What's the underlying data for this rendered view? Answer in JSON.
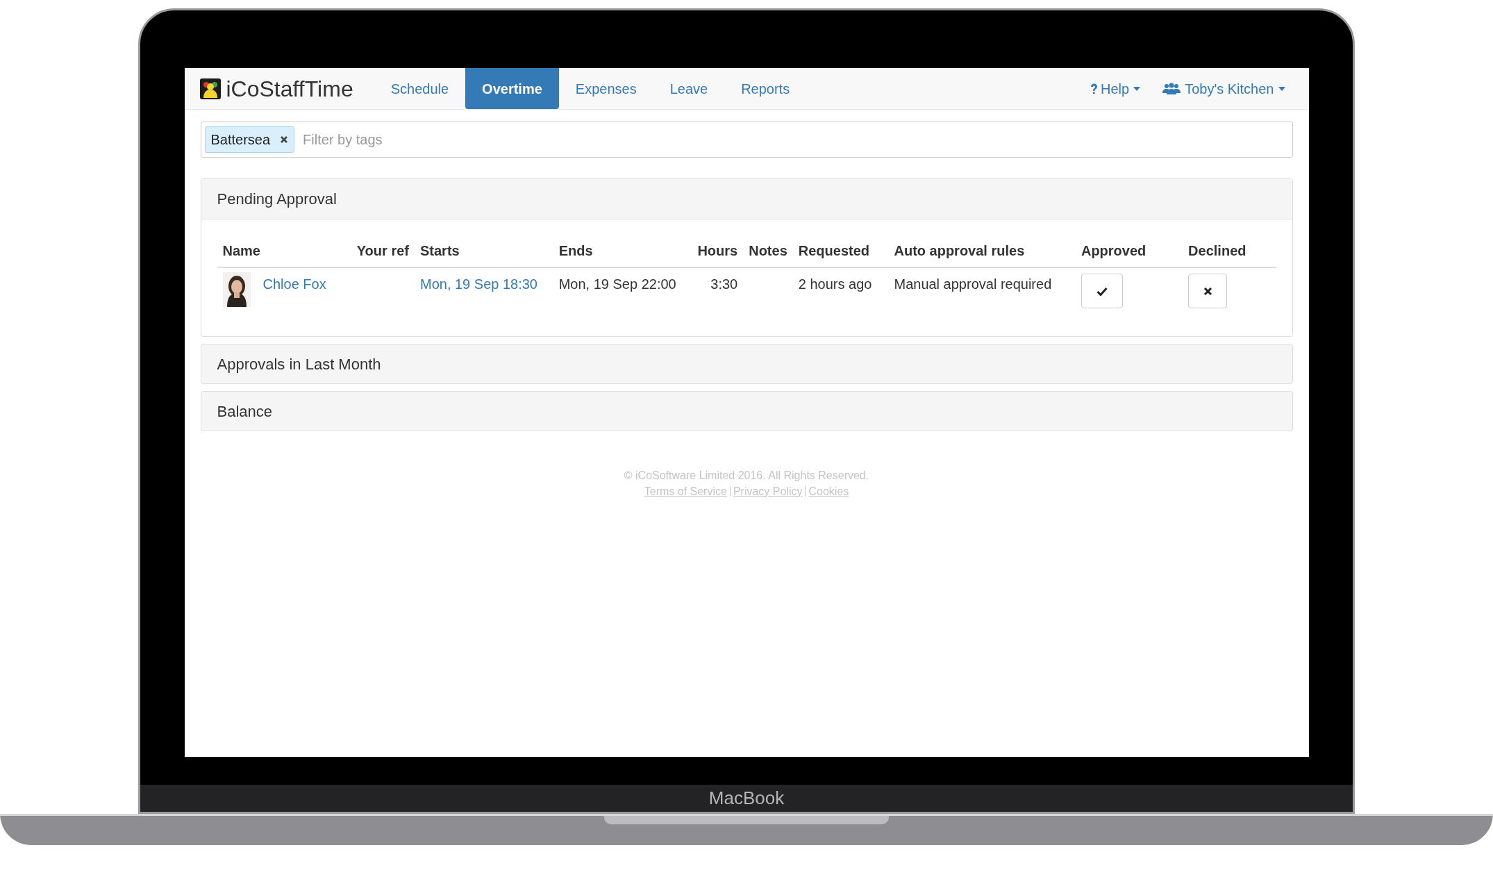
{
  "device": {
    "label": "MacBook"
  },
  "brand": {
    "name": "iCoStaffTime"
  },
  "nav": [
    {
      "label": "Schedule",
      "selected": false
    },
    {
      "label": "Overtime",
      "selected": true
    },
    {
      "label": "Expenses",
      "selected": false
    },
    {
      "label": "Leave",
      "selected": false
    },
    {
      "label": "Reports",
      "selected": false
    }
  ],
  "nav_right": [
    {
      "kind": "help",
      "label": "Help"
    },
    {
      "kind": "team",
      "label": "Toby's Kitchen"
    }
  ],
  "tag_filter": {
    "tags": [
      "Battersea"
    ],
    "placeholder": "Filter by tags"
  },
  "pending": {
    "title": "Pending Approval",
    "columns": [
      "Name",
      "Your ref",
      "Starts",
      "Ends",
      "Hours",
      "Notes",
      "Requested",
      "Auto approval rules",
      "Approved",
      "Declined"
    ],
    "rows": [
      {
        "name": "Chloe Fox",
        "starts": "Mon, 19 Sep 18:30",
        "ends": "Mon, 19 Sep 22:00",
        "hours": "3:30",
        "requested": "2 hours ago",
        "rule": "Manual approval required"
      }
    ]
  },
  "panels": [
    {
      "title": "Approvals in Last Month"
    },
    {
      "title": "Balance"
    }
  ],
  "footer": {
    "copyright": "© iCoSoftware Limited 2016. All Rights Reserved.",
    "links": [
      "Terms of Service",
      "Privacy Policy",
      "Cookies"
    ]
  }
}
